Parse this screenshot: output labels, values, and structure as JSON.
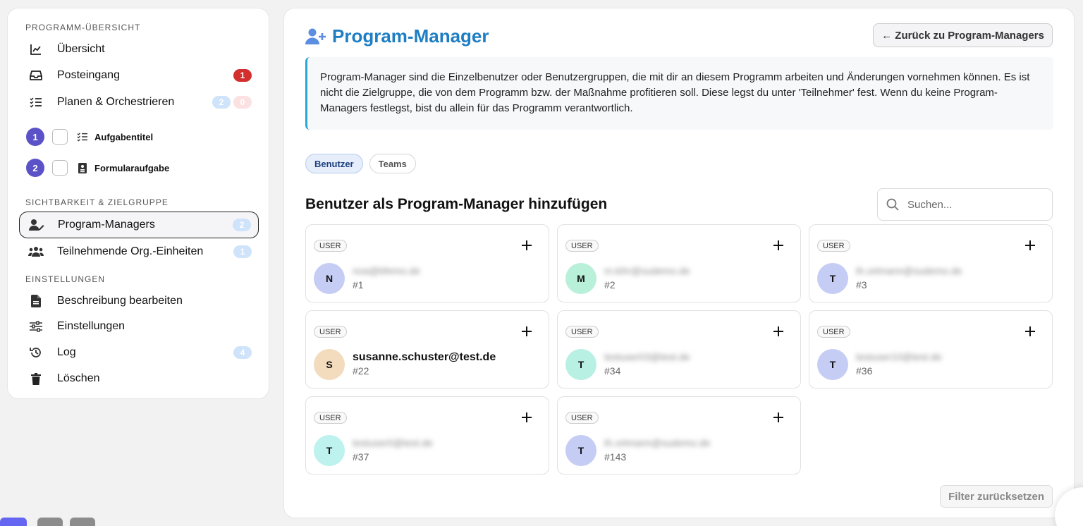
{
  "sidebar": {
    "sections": {
      "overview": "PROGRAMM-ÜBERSICHT",
      "visibility": "SICHTBARKEIT & ZIELGRUPPE",
      "settings": "EINSTELLUNGEN"
    },
    "items": [
      {
        "label": "Übersicht",
        "icon": "chart-line-icon"
      },
      {
        "label": "Posteingang",
        "icon": "inbox-icon",
        "badge": "1"
      },
      {
        "label": "Planen & Orchestrieren",
        "icon": "checklist-icon",
        "badges": [
          "2",
          "0"
        ]
      },
      {
        "label": "Program-Managers",
        "icon": "user-edit-icon",
        "badge": "2"
      },
      {
        "label": "Teilnehmende Org.-Einheiten",
        "icon": "users-icon",
        "badge": "1"
      },
      {
        "label": "Beschreibung bearbeiten",
        "icon": "document-icon"
      },
      {
        "label": "Einstellungen",
        "icon": "sliders-icon"
      },
      {
        "label": "Log",
        "icon": "history-icon",
        "badge": "4"
      },
      {
        "label": "Löschen",
        "icon": "trash-icon"
      }
    ],
    "tasks": [
      {
        "num": "1",
        "label": "Aufgabentitel",
        "icon": "checklist-icon"
      },
      {
        "num": "2",
        "label": "Formularaufgabe",
        "icon": "form-icon"
      }
    ]
  },
  "main": {
    "title": "Program-Manager",
    "back_label": "← Zurück zu Program-Managers",
    "info": "Program-Manager sind die Einzelbenutzer oder Benutzergruppen, die mit dir an diesem Programm arbeiten und Änderungen vornehmen können. Es ist nicht die Zielgruppe, die von dem Programm bzw. der Maßnahme profitieren soll. Diese legst du unter 'Teilnehmer' fest. Wenn du keine Program-Managers festlegst, bist du allein für das Programm verantwortlich.",
    "tabs": [
      "Benutzer",
      "Teams"
    ],
    "section_title": "Benutzer als Program-Manager hinzufügen",
    "search_placeholder": "Suchen...",
    "filter_reset": "Filter zurücksetzen",
    "tag": "USER",
    "users": [
      {
        "initial": "N",
        "email": "noa@bfemo.de",
        "id": "#1",
        "color": "#c5cdf5",
        "blurred": true
      },
      {
        "initial": "M",
        "email": "m.kihr@sudemo.de",
        "id": "#2",
        "color": "#b8f0da",
        "blurred": true
      },
      {
        "initial": "T",
        "email": "th.ortmann@sudemo.de",
        "id": "#3",
        "color": "#c5cdf5",
        "blurred": true
      },
      {
        "initial": "S",
        "email": "susanne.schuster@test.de",
        "id": "#22",
        "color": "#f3dcbd",
        "blurred": false
      },
      {
        "initial": "T",
        "email": "testuser03@test.de",
        "id": "#34",
        "color": "#b8f0e4",
        "blurred": true
      },
      {
        "initial": "T",
        "email": "testuser10@test.de",
        "id": "#36",
        "color": "#c5cdf5",
        "blurred": true
      },
      {
        "initial": "T",
        "email": "testuser0@test.de",
        "id": "#37",
        "color": "#bdf2ee",
        "blurred": true
      },
      {
        "initial": "T",
        "email": "th.ortmann@sudemo.de",
        "id": "#143",
        "color": "#c5cdf5",
        "blurred": true
      }
    ]
  },
  "colors": {
    "accent": "#1e7ec4",
    "info_border": "#27a7d8",
    "badge_red": "#d32f2f",
    "task_num": "#5b52c7"
  }
}
